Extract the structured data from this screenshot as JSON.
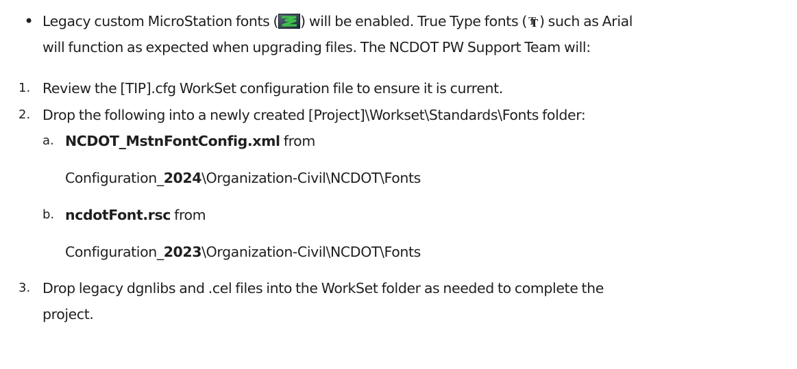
{
  "bullet": {
    "symbol": "•",
    "line1_part1": "Legacy custom MicroStation fonts (",
    "ms_font_icon": "microstation-font-icon",
    "line1_part2": ") will be enabled. True Type fonts (",
    "tt_font_icon": "truetype-font-icon",
    "line1_part3": ") such as Arial",
    "line2": "will function as expected when upgrading files. The NCDOT PW Support Team will:"
  },
  "steps": [
    {
      "marker": "1.",
      "text": "Review the [TIP].cfg WorkSet configuration file to ensure it is current."
    },
    {
      "marker": "2.",
      "text": "Drop the following into a newly created [Project]\\Workset\\Standards\\Fonts folder:",
      "subitems": [
        {
          "marker": "a.",
          "file": "NCDOT_MstnFontConfig.xml",
          "from": " from",
          "path_prefix": "Configuration_",
          "path_year": "2024",
          "path_suffix": "\\Organization-Civil\\NCDOT\\Fonts"
        },
        {
          "marker": "b.",
          "file": "ncdotFont.rsc",
          "from": " from",
          "path_prefix": "Configuration_",
          "path_year": "2023",
          "path_suffix": "\\Organization-Civil\\NCDOT\\Fonts"
        }
      ]
    },
    {
      "marker": "3.",
      "text_line1": "Drop legacy dgnlibs and .cel files into the WorkSet folder as needed to complete the",
      "text_line2": "project."
    }
  ]
}
